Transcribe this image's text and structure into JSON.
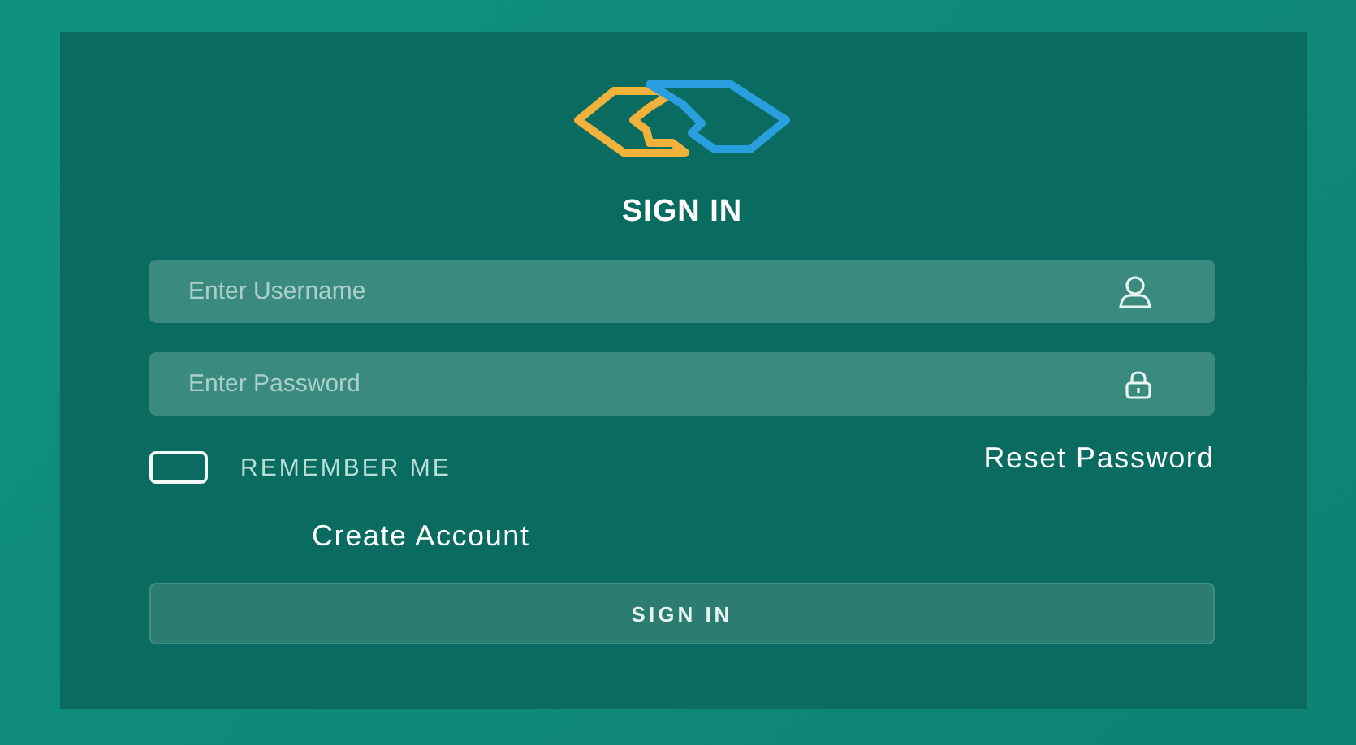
{
  "title": "SIGN IN",
  "username": {
    "placeholder": "Enter Username"
  },
  "password": {
    "placeholder": "Enter Password"
  },
  "remember": {
    "label": "REMEMBER ME",
    "checked": false
  },
  "reset_link": "Reset Password",
  "create_link": "Create Account",
  "submit": "SIGN IN"
}
